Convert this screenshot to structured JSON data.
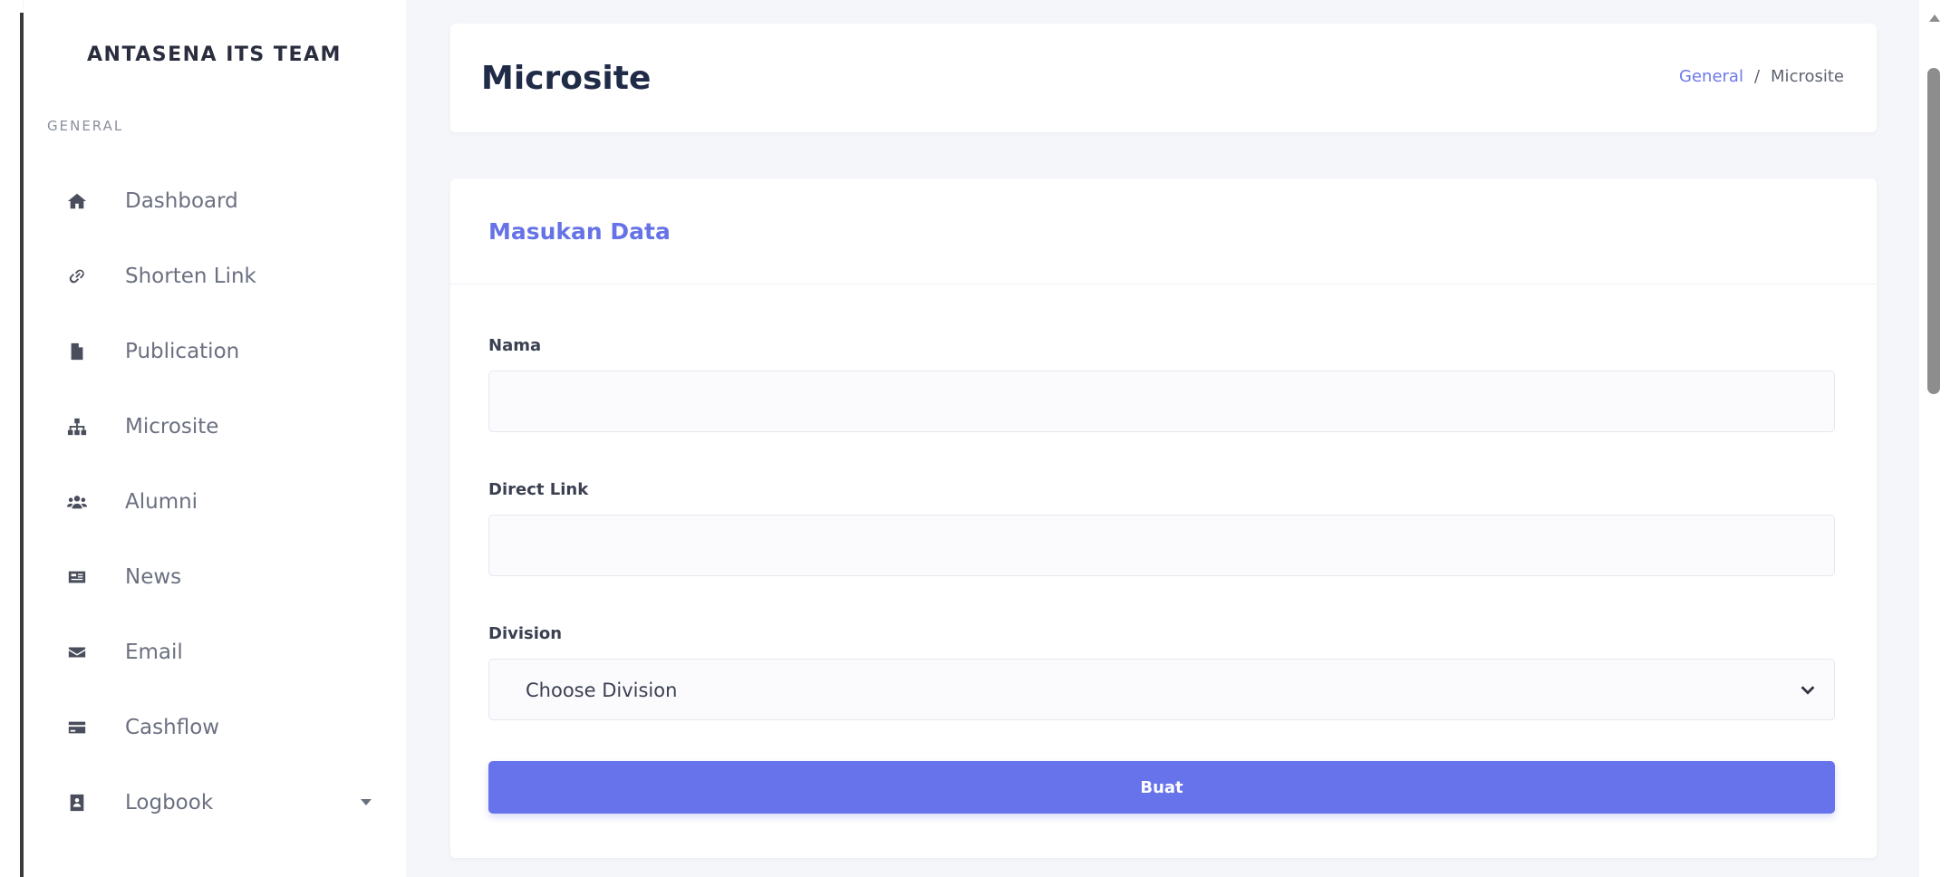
{
  "sidebar": {
    "brand": "ANTASENA ITS TEAM",
    "section_label": "GENERAL",
    "items": [
      {
        "label": "Dashboard",
        "icon": "home-icon"
      },
      {
        "label": "Shorten Link",
        "icon": "link-icon"
      },
      {
        "label": "Publication",
        "icon": "file-icon"
      },
      {
        "label": "Microsite",
        "icon": "sitemap-icon"
      },
      {
        "label": "Alumni",
        "icon": "users-icon"
      },
      {
        "label": "News",
        "icon": "newspaper-icon"
      },
      {
        "label": "Email",
        "icon": "envelope-icon"
      },
      {
        "label": "Cashflow",
        "icon": "credit-card-icon"
      },
      {
        "label": "Logbook",
        "icon": "address-book-icon",
        "has_submenu": true
      }
    ]
  },
  "header": {
    "title": "Microsite",
    "breadcrumb": {
      "parent": "General",
      "separator": "/",
      "current": "Microsite"
    }
  },
  "form": {
    "title": "Masukan Data",
    "fields": {
      "nama": {
        "label": "Nama",
        "value": "",
        "placeholder": ""
      },
      "direct_link": {
        "label": "Direct Link",
        "value": "",
        "placeholder": ""
      },
      "division": {
        "label": "Division",
        "selected": "Choose Division"
      }
    },
    "submit_label": "Buat"
  },
  "colors": {
    "accent": "#6673ea",
    "title_dark": "#202b48",
    "background": "#f5f6fa"
  }
}
